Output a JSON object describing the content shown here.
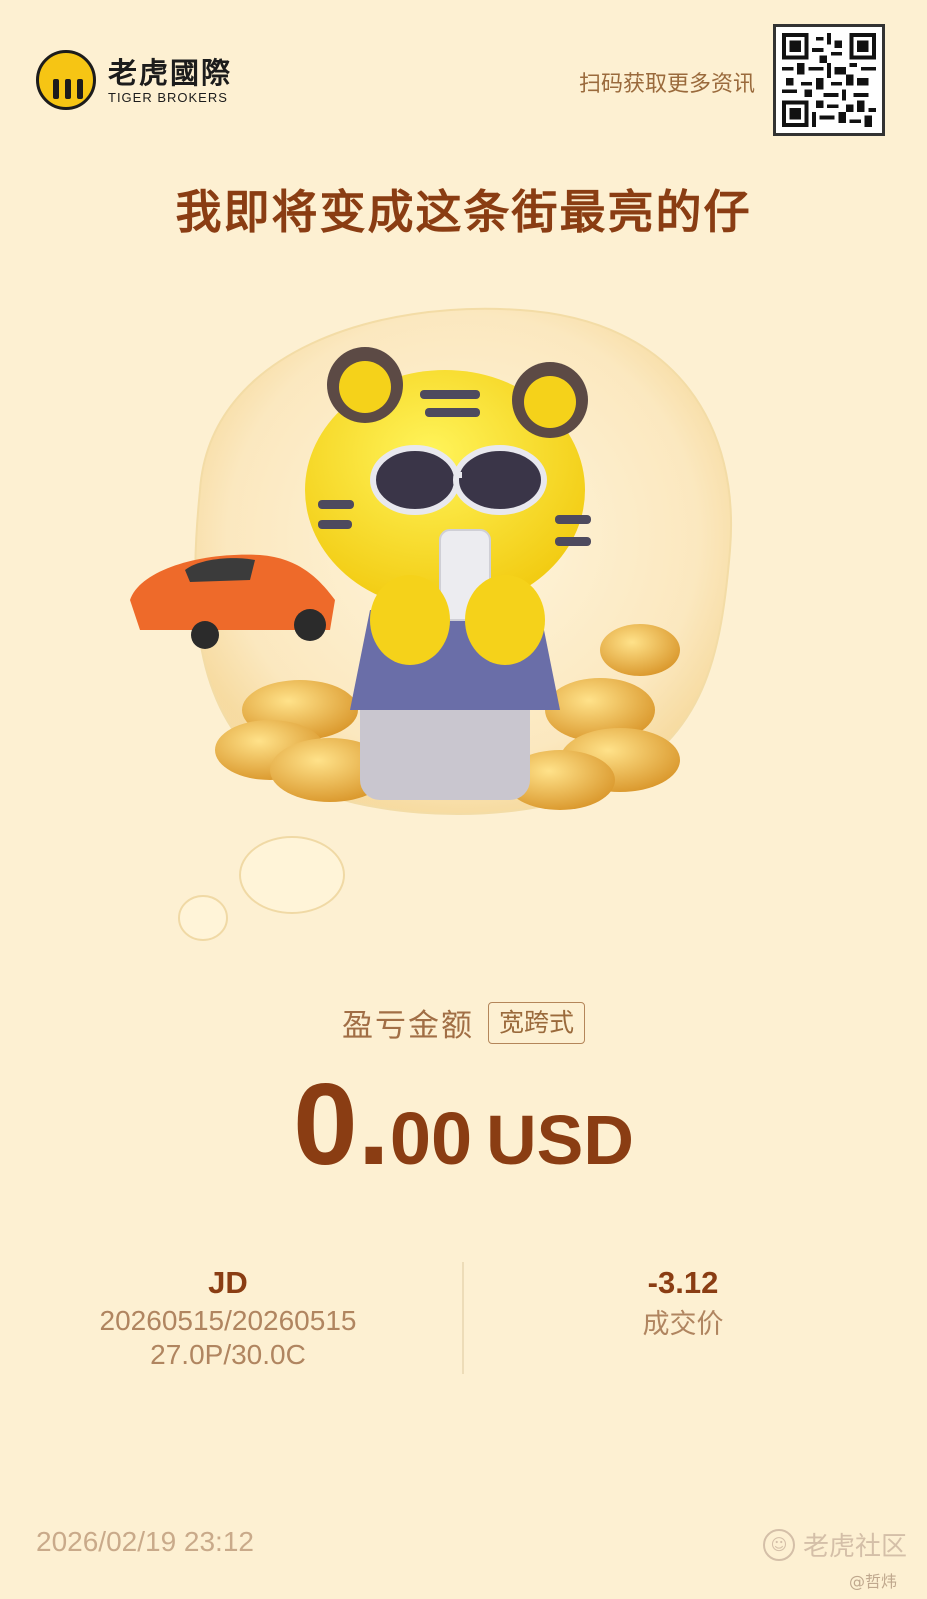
{
  "brand": {
    "name_cn": "老虎國際",
    "name_en": "TIGER BROKERS"
  },
  "qr_prompt": "扫码获取更多资讯",
  "headline": "我即将变成这条街最亮的仔",
  "pnl": {
    "label": "盈亏金额",
    "strategy_tag": "宽跨式",
    "value_int": "0",
    "value_dot": ".",
    "value_dec": "00",
    "currency": "USD"
  },
  "position": {
    "symbol": "JD",
    "expiry": "20260515/20260515",
    "strikes": "27.0P/30.0C"
  },
  "trade": {
    "price": "-3.12",
    "price_label": "成交价"
  },
  "footer": {
    "datetime": "2026/02/19 23:12",
    "watermark": "老虎社区",
    "author": "@哲炜"
  },
  "colors": {
    "background": "#fdf0d2",
    "headline": "#8a3d13",
    "accent_yellow": "#f6c514"
  },
  "icons": [
    "tiger-logo-icon",
    "qr-code-icon",
    "tiger-mascot-illustration",
    "sports-car-illustration",
    "gold-coins-illustration",
    "community-watermark-icon"
  ]
}
